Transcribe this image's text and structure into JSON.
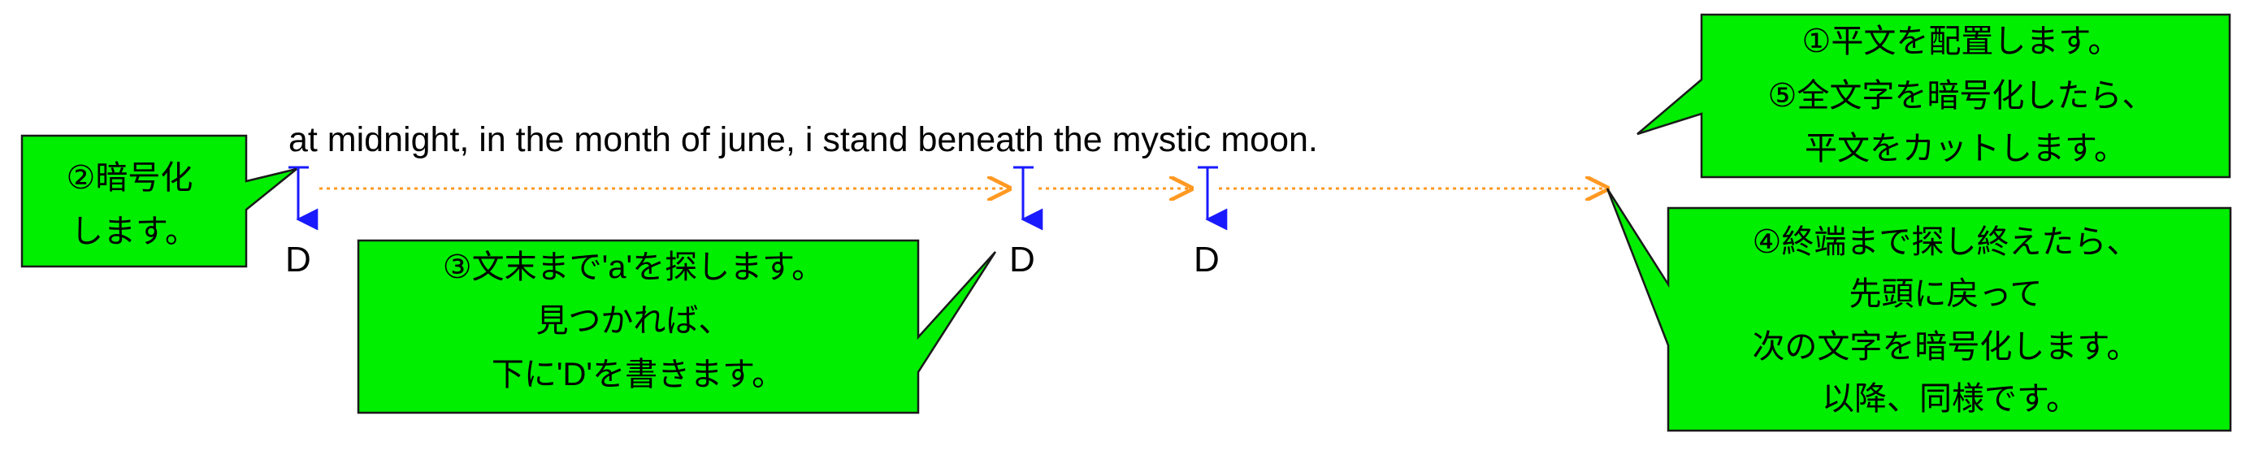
{
  "plaintext": "at midnight, in the month of june, i stand beneath the mystic moon.",
  "marks": [
    "D",
    "D",
    "D"
  ],
  "callouts": {
    "step1": {
      "lines": [
        "①平文を配置します。",
        "⑤全文字を暗号化したら、",
        "平文をカットします。"
      ]
    },
    "step2": {
      "lines": [
        "②暗号化",
        "します。"
      ]
    },
    "step3": {
      "lines": [
        "③文末まで'a'を探します。",
        "見つかれば、",
        "下に'D'を書きます。"
      ]
    },
    "step4": {
      "lines": [
        "④終端まで探し終えたら、",
        "先頭に戻って",
        "次の文字を暗号化します。",
        "以降、同様です。"
      ]
    }
  },
  "colors": {
    "callout_fill": "#00ee00",
    "callout_stroke": "#1a1a1a",
    "marker": "#1a1aff",
    "scan_arrow": "#ff9922",
    "text": "#000000"
  }
}
